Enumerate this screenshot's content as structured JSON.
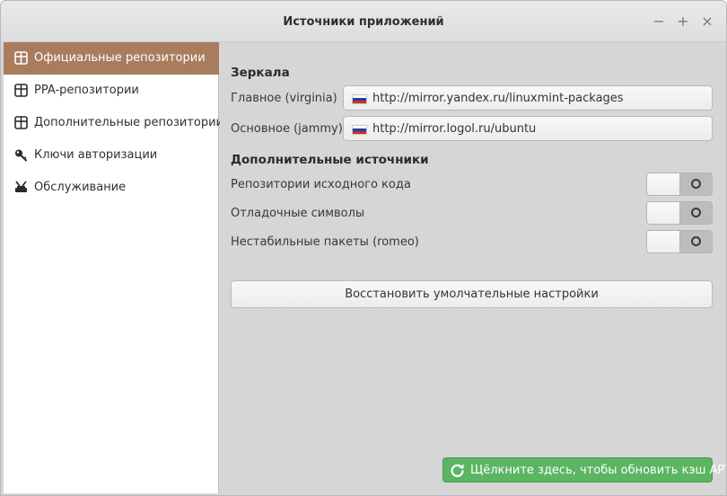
{
  "window": {
    "title": "Источники приложений",
    "controls": {
      "minimize": "−",
      "maximize": "+",
      "close": "×"
    }
  },
  "sidebar": {
    "items": [
      {
        "label": "Официальные репозитории",
        "icon": "package-icon",
        "active": true
      },
      {
        "label": "PPA-репозитории",
        "icon": "package-icon",
        "active": false
      },
      {
        "label": "Дополнительные репозитории",
        "icon": "package-icon",
        "active": false
      },
      {
        "label": "Ключи авторизации",
        "icon": "key-icon",
        "active": false
      },
      {
        "label": "Обслуживание",
        "icon": "tools-icon",
        "active": false
      }
    ]
  },
  "main": {
    "mirrors_heading": "Зеркала",
    "mirrors": [
      {
        "label": "Главное (virginia)",
        "url": "http://mirror.yandex.ru/linuxmint-packages",
        "flag": "russia-flag-icon"
      },
      {
        "label": "Основное (jammy)",
        "url": "http://mirror.logol.ru/ubuntu",
        "flag": "russia-flag-icon"
      }
    ],
    "additional_heading": "Дополнительные источники",
    "options": [
      {
        "label": "Репозитории исходного кода",
        "enabled": false
      },
      {
        "label": "Отладочные символы",
        "enabled": false
      },
      {
        "label": "Нестабильные пакеты (romeo)",
        "enabled": false
      }
    ],
    "restore_button": "Восстановить умолчательные настройки",
    "apt_button": "Щёлкните здесь, чтобы обновить кэш APT"
  },
  "colors": {
    "sidebar_active": "#a87c5d",
    "apt_button": "#5bb562",
    "content_bg": "#d6d6d6"
  }
}
